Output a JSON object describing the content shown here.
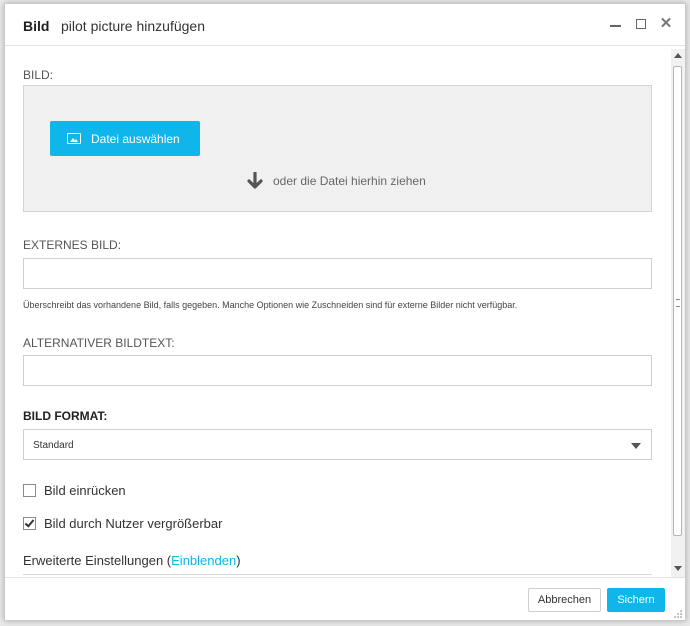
{
  "dialog": {
    "title": "Bild",
    "subtitle": "pilot picture hinzufügen",
    "controls": {
      "minimize_icon": "minimize-icon",
      "maximize_icon": "maximize-icon",
      "close_icon": "close-icon",
      "close_glyph": "✕"
    }
  },
  "image_field": {
    "label": "BILD:",
    "choose_button": "Datei auswählen",
    "choose_icon": "image-icon",
    "drop_hint": "oder die Datei hierhin ziehen",
    "drop_icon": "arrow-down-icon"
  },
  "external_image": {
    "label": "EXTERNES BILD:",
    "value": "",
    "help": "Überschreibt das vorhandene Bild, falls gegeben. Manche Optionen wie Zuschneiden sind für externe Bilder nicht verfügbar."
  },
  "alt_text": {
    "label": "ALTERNATIVER BILDTEXT:",
    "value": ""
  },
  "format": {
    "label": "BILD FORMAT:",
    "selected": "Standard"
  },
  "options": [
    {
      "label": "Bild einrücken",
      "checked": false
    },
    {
      "label": "Bild durch Nutzer vergrößerbar",
      "checked": true
    }
  ],
  "advanced": {
    "text": "Erweiterte Einstellungen (",
    "link": "Einblenden",
    "close": ")"
  },
  "footer": {
    "cancel": "Abbrechen",
    "save": "Sichern"
  },
  "colors": {
    "accent": "#10b6ea",
    "dropzone_bg": "#f0f0f0"
  }
}
